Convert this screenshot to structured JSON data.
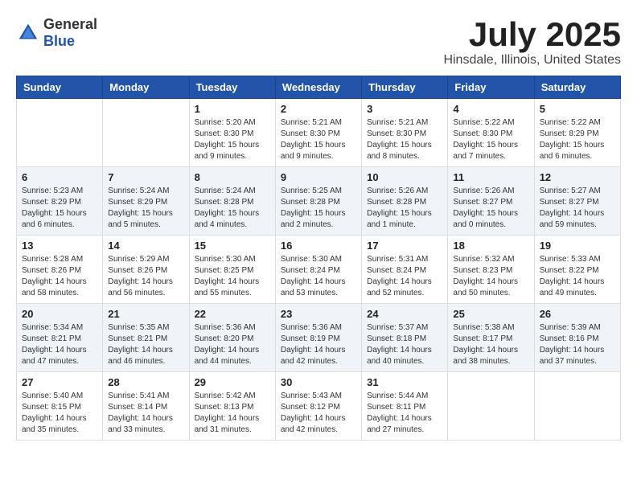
{
  "header": {
    "logo_general": "General",
    "logo_blue": "Blue",
    "month_title": "July 2025",
    "location": "Hinsdale, Illinois, United States"
  },
  "days_of_week": [
    "Sunday",
    "Monday",
    "Tuesday",
    "Wednesday",
    "Thursday",
    "Friday",
    "Saturday"
  ],
  "weeks": [
    [
      {
        "day": "",
        "sunrise": "",
        "sunset": "",
        "daylight": ""
      },
      {
        "day": "",
        "sunrise": "",
        "sunset": "",
        "daylight": ""
      },
      {
        "day": "1",
        "sunrise": "Sunrise: 5:20 AM",
        "sunset": "Sunset: 8:30 PM",
        "daylight": "Daylight: 15 hours and 9 minutes."
      },
      {
        "day": "2",
        "sunrise": "Sunrise: 5:21 AM",
        "sunset": "Sunset: 8:30 PM",
        "daylight": "Daylight: 15 hours and 9 minutes."
      },
      {
        "day": "3",
        "sunrise": "Sunrise: 5:21 AM",
        "sunset": "Sunset: 8:30 PM",
        "daylight": "Daylight: 15 hours and 8 minutes."
      },
      {
        "day": "4",
        "sunrise": "Sunrise: 5:22 AM",
        "sunset": "Sunset: 8:30 PM",
        "daylight": "Daylight: 15 hours and 7 minutes."
      },
      {
        "day": "5",
        "sunrise": "Sunrise: 5:22 AM",
        "sunset": "Sunset: 8:29 PM",
        "daylight": "Daylight: 15 hours and 6 minutes."
      }
    ],
    [
      {
        "day": "6",
        "sunrise": "Sunrise: 5:23 AM",
        "sunset": "Sunset: 8:29 PM",
        "daylight": "Daylight: 15 hours and 6 minutes."
      },
      {
        "day": "7",
        "sunrise": "Sunrise: 5:24 AM",
        "sunset": "Sunset: 8:29 PM",
        "daylight": "Daylight: 15 hours and 5 minutes."
      },
      {
        "day": "8",
        "sunrise": "Sunrise: 5:24 AM",
        "sunset": "Sunset: 8:28 PM",
        "daylight": "Daylight: 15 hours and 4 minutes."
      },
      {
        "day": "9",
        "sunrise": "Sunrise: 5:25 AM",
        "sunset": "Sunset: 8:28 PM",
        "daylight": "Daylight: 15 hours and 2 minutes."
      },
      {
        "day": "10",
        "sunrise": "Sunrise: 5:26 AM",
        "sunset": "Sunset: 8:28 PM",
        "daylight": "Daylight: 15 hours and 1 minute."
      },
      {
        "day": "11",
        "sunrise": "Sunrise: 5:26 AM",
        "sunset": "Sunset: 8:27 PM",
        "daylight": "Daylight: 15 hours and 0 minutes."
      },
      {
        "day": "12",
        "sunrise": "Sunrise: 5:27 AM",
        "sunset": "Sunset: 8:27 PM",
        "daylight": "Daylight: 14 hours and 59 minutes."
      }
    ],
    [
      {
        "day": "13",
        "sunrise": "Sunrise: 5:28 AM",
        "sunset": "Sunset: 8:26 PM",
        "daylight": "Daylight: 14 hours and 58 minutes."
      },
      {
        "day": "14",
        "sunrise": "Sunrise: 5:29 AM",
        "sunset": "Sunset: 8:26 PM",
        "daylight": "Daylight: 14 hours and 56 minutes."
      },
      {
        "day": "15",
        "sunrise": "Sunrise: 5:30 AM",
        "sunset": "Sunset: 8:25 PM",
        "daylight": "Daylight: 14 hours and 55 minutes."
      },
      {
        "day": "16",
        "sunrise": "Sunrise: 5:30 AM",
        "sunset": "Sunset: 8:24 PM",
        "daylight": "Daylight: 14 hours and 53 minutes."
      },
      {
        "day": "17",
        "sunrise": "Sunrise: 5:31 AM",
        "sunset": "Sunset: 8:24 PM",
        "daylight": "Daylight: 14 hours and 52 minutes."
      },
      {
        "day": "18",
        "sunrise": "Sunrise: 5:32 AM",
        "sunset": "Sunset: 8:23 PM",
        "daylight": "Daylight: 14 hours and 50 minutes."
      },
      {
        "day": "19",
        "sunrise": "Sunrise: 5:33 AM",
        "sunset": "Sunset: 8:22 PM",
        "daylight": "Daylight: 14 hours and 49 minutes."
      }
    ],
    [
      {
        "day": "20",
        "sunrise": "Sunrise: 5:34 AM",
        "sunset": "Sunset: 8:21 PM",
        "daylight": "Daylight: 14 hours and 47 minutes."
      },
      {
        "day": "21",
        "sunrise": "Sunrise: 5:35 AM",
        "sunset": "Sunset: 8:21 PM",
        "daylight": "Daylight: 14 hours and 46 minutes."
      },
      {
        "day": "22",
        "sunrise": "Sunrise: 5:36 AM",
        "sunset": "Sunset: 8:20 PM",
        "daylight": "Daylight: 14 hours and 44 minutes."
      },
      {
        "day": "23",
        "sunrise": "Sunrise: 5:36 AM",
        "sunset": "Sunset: 8:19 PM",
        "daylight": "Daylight: 14 hours and 42 minutes."
      },
      {
        "day": "24",
        "sunrise": "Sunrise: 5:37 AM",
        "sunset": "Sunset: 8:18 PM",
        "daylight": "Daylight: 14 hours and 40 minutes."
      },
      {
        "day": "25",
        "sunrise": "Sunrise: 5:38 AM",
        "sunset": "Sunset: 8:17 PM",
        "daylight": "Daylight: 14 hours and 38 minutes."
      },
      {
        "day": "26",
        "sunrise": "Sunrise: 5:39 AM",
        "sunset": "Sunset: 8:16 PM",
        "daylight": "Daylight: 14 hours and 37 minutes."
      }
    ],
    [
      {
        "day": "27",
        "sunrise": "Sunrise: 5:40 AM",
        "sunset": "Sunset: 8:15 PM",
        "daylight": "Daylight: 14 hours and 35 minutes."
      },
      {
        "day": "28",
        "sunrise": "Sunrise: 5:41 AM",
        "sunset": "Sunset: 8:14 PM",
        "daylight": "Daylight: 14 hours and 33 minutes."
      },
      {
        "day": "29",
        "sunrise": "Sunrise: 5:42 AM",
        "sunset": "Sunset: 8:13 PM",
        "daylight": "Daylight: 14 hours and 31 minutes."
      },
      {
        "day": "30",
        "sunrise": "Sunrise: 5:43 AM",
        "sunset": "Sunset: 8:12 PM",
        "daylight": "Daylight: 14 hours and 42 minutes."
      },
      {
        "day": "31",
        "sunrise": "Sunrise: 5:44 AM",
        "sunset": "Sunset: 8:11 PM",
        "daylight": "Daylight: 14 hours and 27 minutes."
      },
      {
        "day": "",
        "sunrise": "",
        "sunset": "",
        "daylight": ""
      },
      {
        "day": "",
        "sunrise": "",
        "sunset": "",
        "daylight": ""
      }
    ]
  ]
}
